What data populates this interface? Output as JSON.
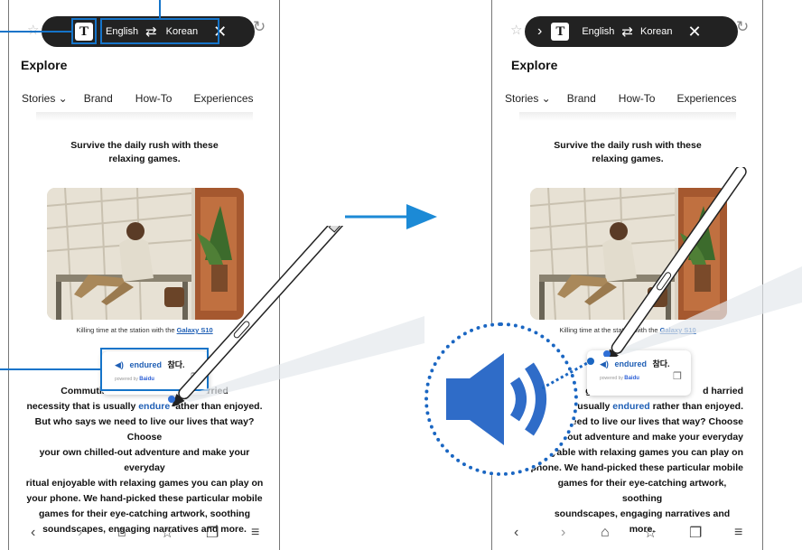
{
  "toolbar": {
    "source_lang": "English",
    "target_lang": "Korean",
    "text_icon": "T",
    "swap_icon": "swap-arrows-icon",
    "close_icon": "close-icon",
    "expand_icon": "chevron-right-icon"
  },
  "page": {
    "section_title": "Explore",
    "tabs": [
      "Stories ⌄",
      "Brand",
      "How-To",
      "Experiences"
    ],
    "headline": "Survive the daily rush with these relaxing games.",
    "caption_prefix": "Killing time at the station with the ",
    "caption_link": "Galaxy S10",
    "body_left": {
      "line1_start": "Commutin",
      "line1_end": "harried",
      "line2_start": "necessity that is usually ",
      "line2_word": "endure",
      "line2_end": "ather than enjoyed."
    },
    "body_right": {
      "line1_start": "g:",
      "line1_end": "d harried",
      "line2_start": "t is usually ",
      "line2_word": "endured",
      "line2_end": " rather than enjoyed."
    },
    "body_lines_left": [
      "But who says we need to live our lives that way? Choose",
      "your own chilled-out adventure and make your everyday",
      "ritual enjoyable with relaxing games you can play on",
      "your phone. We hand-picked these particular mobile",
      "games for their eye-catching artwork, soothing",
      "soundscapes, engaging narratives and more."
    ],
    "body_lines_right": [
      "t we need to live our lives that way? Choose",
      "led-out adventure and make your everyday",
      "joyable with relaxing games you can play on",
      "phone. We hand-picked these particular mobile",
      "games for their eye-catching artwork, soothing",
      "soundscapes, engaging narratives and more."
    ]
  },
  "popup": {
    "speaker_icon": "speaker-icon",
    "word": "endured",
    "translation": "참다.",
    "powered_by": "powered by",
    "brand": "Baidu",
    "copy_icon": "copy-icon"
  },
  "nav": [
    "back-icon",
    "forward-icon",
    "home-icon",
    "bookmarks-icon",
    "tabs-icon",
    "menu-icon"
  ],
  "colors": {
    "accent": "#1574c9",
    "toolbar_bg": "#222222",
    "link": "#1f5fb5"
  }
}
